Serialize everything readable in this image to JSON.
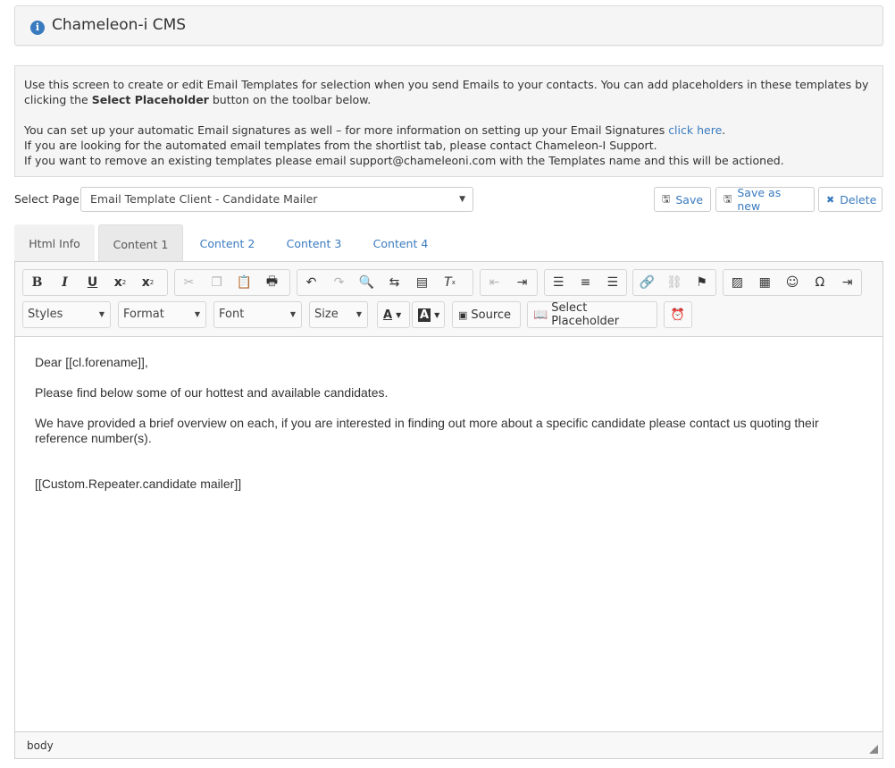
{
  "header": {
    "title": "Chameleon-i CMS",
    "info_icon": "i"
  },
  "notice": {
    "line1_pre": "Use this screen to create or edit Email Templates for selection when you send Emails to your contacts. You can add placeholders in these templates by clicking the ",
    "line1_bold": "Select Placeholder",
    "line1_post": " button on the toolbar below.",
    "line2_pre": "You can set up your automatic Email signatures as well – for more information on setting up your Email Signatures ",
    "line2_link": "click here",
    "line2_post": ".",
    "line3": "If you are looking for the automated email templates from the shortlist tab, please contact Chameleon-I Support.",
    "line4": "If you want to remove an existing templates please email support@chameleoni.com with the Templates name and this will be actioned."
  },
  "select_page": {
    "label": "Select Page",
    "value": "Email Template Client - Candidate Mailer"
  },
  "actions": {
    "save": "Save",
    "save_as_new": "Save as new",
    "delete": "Delete"
  },
  "tabs": [
    {
      "label": "Html Info"
    },
    {
      "label": "Content 1"
    },
    {
      "label": "Content 2"
    },
    {
      "label": "Content 3"
    },
    {
      "label": "Content 4"
    }
  ],
  "toolbar": {
    "styles": "Styles",
    "format": "Format",
    "font": "Font",
    "size": "Size",
    "source": "Source",
    "select_placeholder": "Select Placeholder"
  },
  "content": {
    "greeting": "Dear [[cl.forename]],",
    "para1": "Please find below some of our hottest and available candidates.",
    "para2": "We have provided a brief overview on each, if you are interested in finding out more about a specific candidate please contact us quoting their reference number(s).",
    "placeholder": "[[Custom.Repeater.candidate mailer]]"
  },
  "status": {
    "path": "body"
  }
}
